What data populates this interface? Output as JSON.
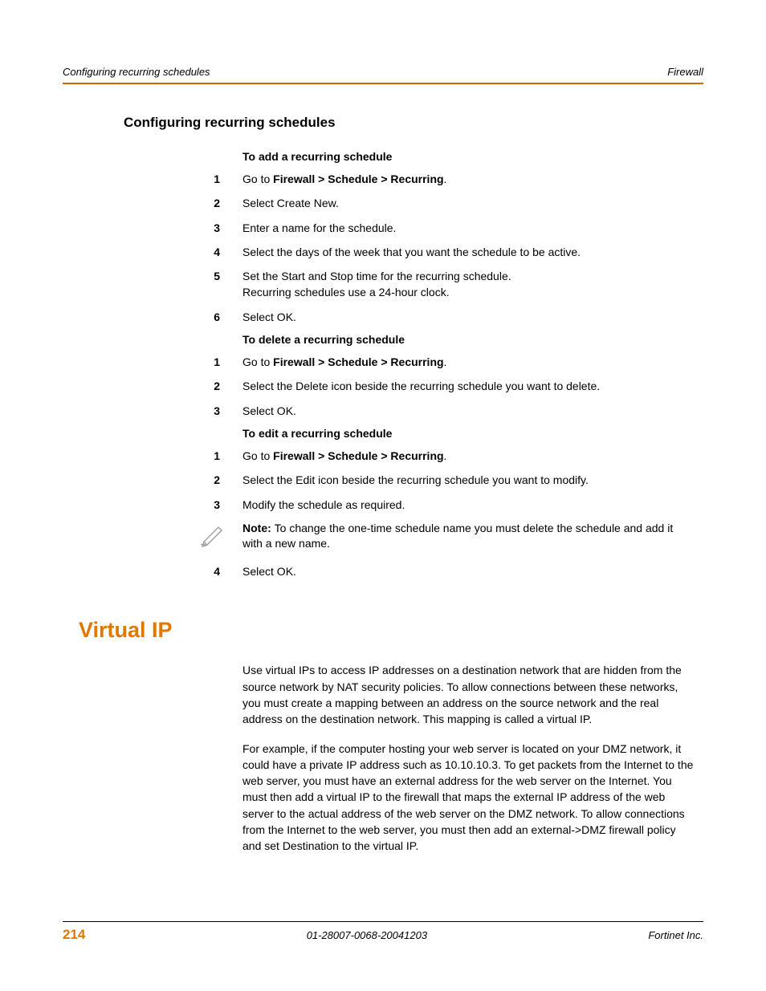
{
  "header": {
    "left": "Configuring recurring schedules",
    "right": "Firewall"
  },
  "section_title": "Configuring recurring schedules",
  "sub1": "To add a recurring schedule",
  "s1": {
    "n1": "1",
    "t1a": "Go to ",
    "t1b": "Firewall > Schedule > Recurring",
    "t1c": ".",
    "n2": "2",
    "t2": "Select Create New.",
    "n3": "3",
    "t3": "Enter a name for the schedule.",
    "n4": "4",
    "t4": "Select the days of the week that you want the schedule to be active.",
    "n5": "5",
    "t5a": "Set the Start and Stop time for the recurring schedule.",
    "t5b": "Recurring schedules use a 24-hour clock.",
    "n6": "6",
    "t6": "Select OK."
  },
  "sub2": "To delete a recurring schedule",
  "s2": {
    "n1": "1",
    "t1a": "Go to ",
    "t1b": "Firewall > Schedule > Recurring",
    "t1c": ".",
    "n2": "2",
    "t2": "Select the Delete icon beside the recurring schedule you want to delete.",
    "n3": "3",
    "t3": "Select OK."
  },
  "sub3": "To edit a recurring schedule",
  "s3": {
    "n1": "1",
    "t1a": "Go to ",
    "t1b": "Firewall > Schedule > Recurring",
    "t1c": ".",
    "n2": "2",
    "t2": "Select the Edit icon beside the recurring schedule you want to modify.",
    "n3": "3",
    "t3": "Modify the schedule as required."
  },
  "note": {
    "label": "Note: ",
    "text": "To change the one-time schedule name you must delete the schedule and add it with a new name."
  },
  "s3b": {
    "n4": "4",
    "t4": "Select OK."
  },
  "chapter": "Virtual IP",
  "p1": "Use virtual IPs to access IP addresses on a destination network that are hidden from the source network by NAT security policies. To allow connections between these networks, you must create a mapping between an address on the source network and the real address on the destination network. This mapping is called a virtual IP.",
  "p2": "For example, if the computer hosting your web server is located on your DMZ network, it could have a private IP address such as 10.10.10.3. To get packets from the Internet to the web server, you must have an external address for the web server on the Internet. You must then add a virtual IP to the firewall that maps the external IP address of the web server to the actual address of the web server on the DMZ network. To allow connections from the Internet to the web server, you must then add an external->DMZ firewall policy and set Destination to the virtual IP.",
  "footer": {
    "page": "214",
    "center": "01-28007-0068-20041203",
    "right": "Fortinet Inc."
  }
}
